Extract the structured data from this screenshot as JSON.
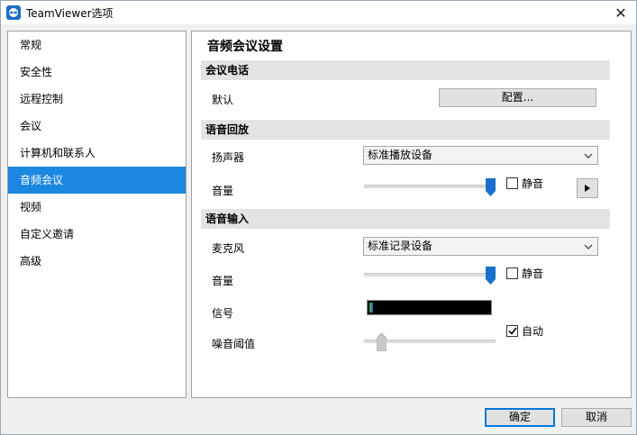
{
  "window": {
    "title": "TeamViewer选项"
  },
  "sidebar": {
    "items": [
      {
        "label": "常规"
      },
      {
        "label": "安全性"
      },
      {
        "label": "远程控制"
      },
      {
        "label": "会议"
      },
      {
        "label": "计算机和联系人"
      },
      {
        "label": "音频会议",
        "active": true
      },
      {
        "label": "视频"
      },
      {
        "label": "自定义邀请"
      },
      {
        "label": "高级"
      }
    ]
  },
  "main": {
    "title": "音频会议设置",
    "conference_call": {
      "header": "会议电话",
      "default_label": "默认",
      "configure_button": "配置..."
    },
    "voice_playback": {
      "header": "语音回放",
      "speaker_label": "扬声器",
      "speaker_device": "标准播放设备",
      "volume_label": "音量",
      "volume_level": 1.0,
      "mute_label": "静音",
      "mute_checked": false
    },
    "voice_input": {
      "header": "语音输入",
      "mic_label": "麦克风",
      "mic_device": "标准记录设备",
      "volume_label": "音量",
      "volume_level": 1.0,
      "mute_label": "静音",
      "mute_checked": false,
      "signal_label": "信号",
      "noise_label": "噪音阈值",
      "noise_level": 0.1,
      "auto_label": "自动",
      "auto_checked": true
    }
  },
  "footer": {
    "ok": "确定",
    "cancel": "取消"
  },
  "colors": {
    "accent": "#1b87e0",
    "slider_thumb": "#1a6fcc",
    "slider_thumb_disabled": "#c8c8c8"
  },
  "icons": {
    "app": "teamviewer-icon",
    "close": "close-icon",
    "dropdown": "chevron-down-icon",
    "play": "play-icon",
    "check": "check-icon"
  }
}
